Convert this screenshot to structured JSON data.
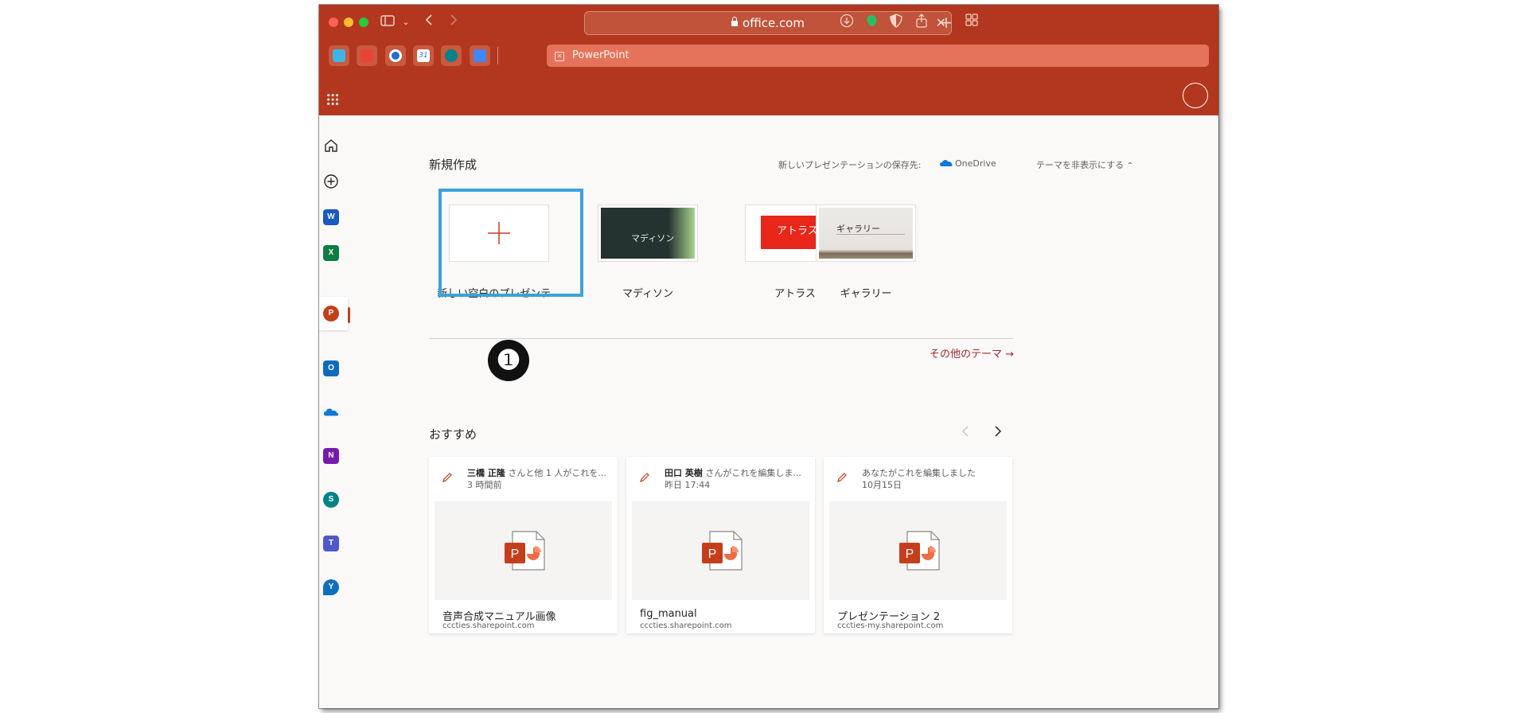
{
  "browser": {
    "url": "office.com",
    "tab_label": "PowerPoint",
    "favicons": [
      "c-app-icon",
      "chat-app-icon",
      "calendar-app-icon",
      "calendar-31-icon",
      "sharepoint-icon",
      "translate-icon"
    ],
    "calendar_day": "31"
  },
  "colors": {
    "brand": "#b3371e",
    "accent": "#c43e1c",
    "selection": "#3aa2dc"
  },
  "rail": {
    "items": [
      "home-icon",
      "create-icon",
      "word-icon",
      "excel-icon",
      "powerpoint-icon",
      "outlook-icon",
      "onedrive-icon",
      "onenote-icon",
      "sharepoint-icon",
      "teams-icon",
      "yammer-icon"
    ],
    "letters": {
      "word": "W",
      "excel": "X",
      "powerpoint": "P",
      "outlook": "O",
      "onenote": "N",
      "sharepoint": "S",
      "teams": "T",
      "yammer": "Y"
    }
  },
  "new_section": {
    "title": "新規作成",
    "save_location_label": "新しいプレゼンテーションの保存先:",
    "save_location": "OneDrive",
    "hide_themes": "テーマを非表示にする",
    "templates": [
      {
        "label": "新しい空白のプレゼンテ...",
        "selected": true
      },
      {
        "label": "マディソン",
        "thumb_text": "マディソン"
      },
      {
        "label": "アトラス",
        "thumb_text": "アトラス"
      },
      {
        "label": "ギャラリー",
        "thumb_text": "ギャラリー"
      }
    ],
    "more_themes": "その他のテーマ",
    "step_badge": "❶"
  },
  "recommended": {
    "title": "おすすめ",
    "cards": [
      {
        "who_bold": "三橋 正隆",
        "who_rest": " さんと他 1 人がこれを...",
        "when": "3 時間前",
        "name": "音声合成マニュアル画像",
        "site": "cccties.sharepoint.com"
      },
      {
        "who_bold": "田口 英樹",
        "who_rest": " さんがこれを編集しま...",
        "when": "昨日 17:44",
        "name": "fig_manual",
        "site": "cccties.sharepoint.com"
      },
      {
        "who_bold": "",
        "who_rest": "あなたがこれを編集しました",
        "when": "10月15日",
        "name": "プレゼンテーション 2",
        "site": "cccties-my.sharepoint.com"
      }
    ]
  }
}
